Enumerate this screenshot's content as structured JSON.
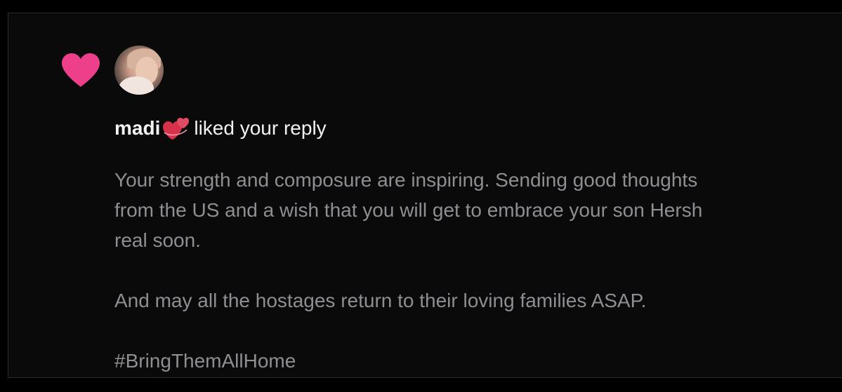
{
  "notification": {
    "username": "madi",
    "action": "liked your reply",
    "reply_lines": [
      "Your strength and composure are inspiring. Sending good thoughts",
      "from the US and a wish that you will get to embrace your son Hersh",
      "real soon."
    ],
    "paragraph_2": "And may all the hostages return to their loving families ASAP.",
    "hashtag": "#BringThemAllHome"
  },
  "icons": {
    "activity": "heart-icon",
    "username_emoji": "two-hearts-icon"
  },
  "colors": {
    "background": "#000000",
    "card": "#0a0a0b",
    "heart": "#ee3f8b",
    "primary_text": "#f2f2f2",
    "secondary_text": "#8e8e93"
  }
}
